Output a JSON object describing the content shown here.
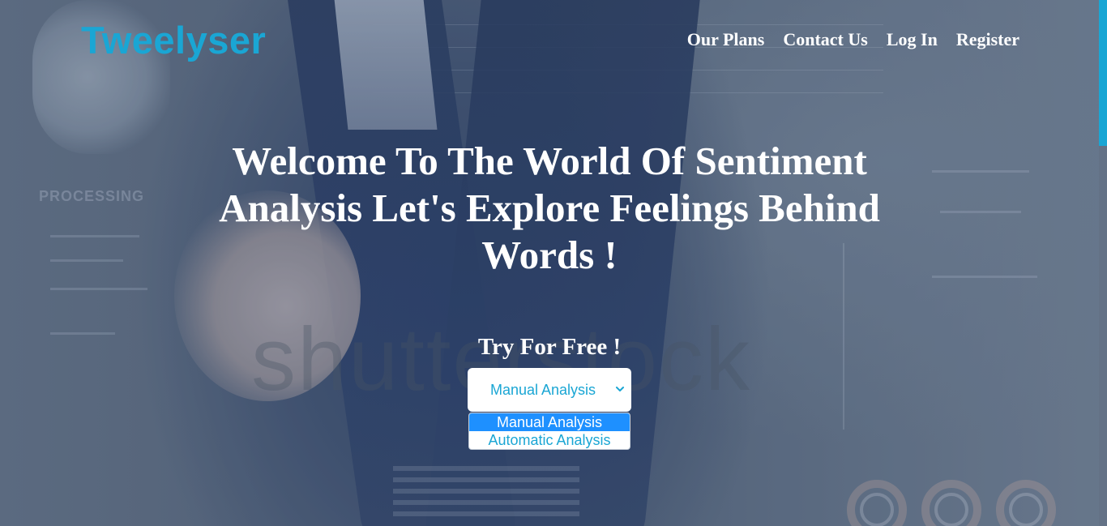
{
  "header": {
    "logo": "Tweelyser",
    "nav": [
      {
        "label": "Our Plans"
      },
      {
        "label": "Contact Us"
      },
      {
        "label": "Log In"
      },
      {
        "label": "Register"
      }
    ]
  },
  "hero": {
    "title": "Welcome To The World Of Sentiment Analysis Let's Explore Feelings Behind Words !",
    "try_label": "Try For Free !"
  },
  "analysis_select": {
    "selected": "Manual Analysis",
    "options": [
      "Manual Analysis",
      "Automatic Analysis"
    ],
    "icon": "chevron-down-icon"
  },
  "colors": {
    "brand": "#1aa6d4",
    "selected_option_bg": "#1e90ff",
    "text": "#ffffff"
  }
}
